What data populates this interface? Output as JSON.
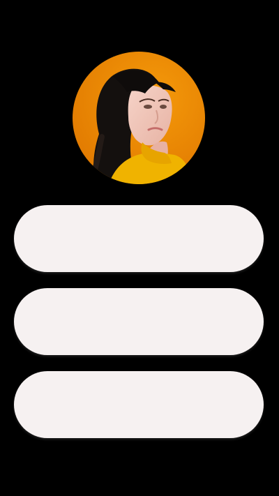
{
  "profile": {
    "avatar": {
      "icon": "profile-photo",
      "background_color": "#f08a00",
      "sweater_color": "#f1b300"
    }
  },
  "menu": {
    "items": [
      {
        "label": ""
      },
      {
        "label": ""
      },
      {
        "label": ""
      }
    ],
    "item_color": "#f6f1f1"
  }
}
